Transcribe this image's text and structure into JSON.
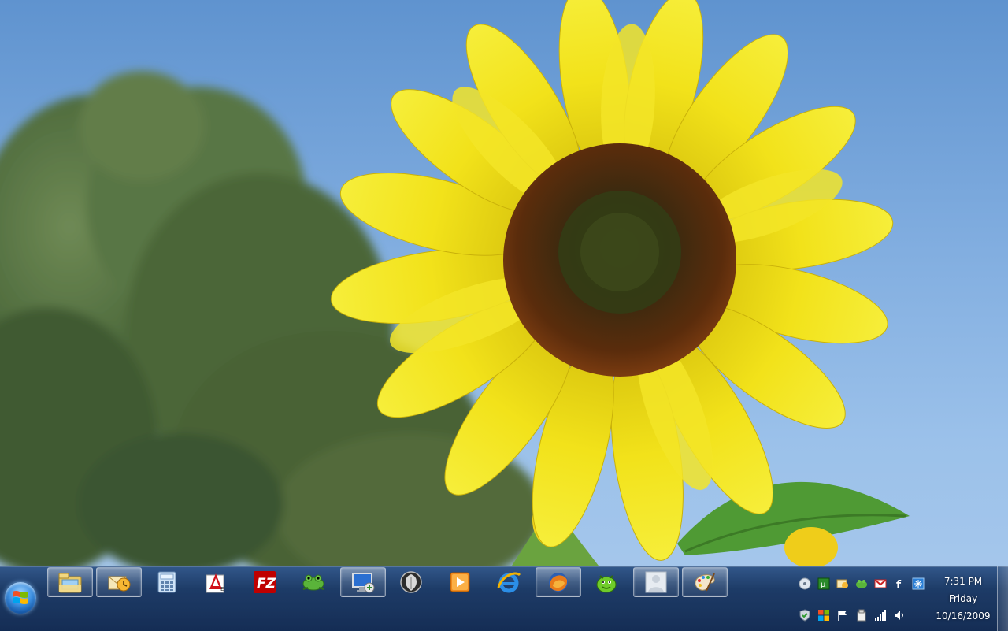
{
  "desktop": {
    "wallpaper_icon": "sunflower-wallpaper"
  },
  "taskbar": {
    "start_icon": "windows-logo-icon",
    "pinned": [
      {
        "name": "windows-explorer",
        "icon": "folder-library-icon",
        "active": true
      },
      {
        "name": "outlook",
        "icon": "envelope-clock-icon",
        "active": true
      },
      {
        "name": "calculator",
        "icon": "calculator-icon",
        "active": false
      },
      {
        "name": "acrobat",
        "icon": "acrobat-icon",
        "active": false
      },
      {
        "name": "filezilla",
        "icon": "filezilla-icon",
        "active": false
      },
      {
        "name": "frog-app",
        "icon": "frog-icon",
        "active": false
      },
      {
        "name": "remote-desktop",
        "icon": "remote-desktop-icon",
        "active": true
      },
      {
        "name": "shield-app",
        "icon": "shield-icon",
        "active": false
      },
      {
        "name": "media-player",
        "icon": "media-play-icon",
        "active": false
      },
      {
        "name": "internet-explorer",
        "icon": "internet-explorer-icon",
        "active": false
      },
      {
        "name": "firefox",
        "icon": "firefox-icon",
        "active": true
      },
      {
        "name": "chat-app",
        "icon": "green-face-icon",
        "active": false
      },
      {
        "name": "contacts",
        "icon": "user-silhouette-icon",
        "active": true
      },
      {
        "name": "paint",
        "icon": "paint-palette-icon",
        "active": true
      }
    ],
    "tray_icons_row1": [
      "cd-icon",
      "utorrent-icon",
      "outlook-tray-icon",
      "frog-tray-icon",
      "gmail-notifier-icon",
      "facebook-icon",
      "snowflake-icon"
    ],
    "tray_icons_row2": [
      "security-shield-icon",
      "windows-flag-icon",
      "action-center-flag-icon",
      "device-icon",
      "network-signal-icon",
      "volume-icon"
    ],
    "clock": {
      "time": "7:31 PM",
      "day": "Friday",
      "date": "10/16/2009"
    }
  }
}
